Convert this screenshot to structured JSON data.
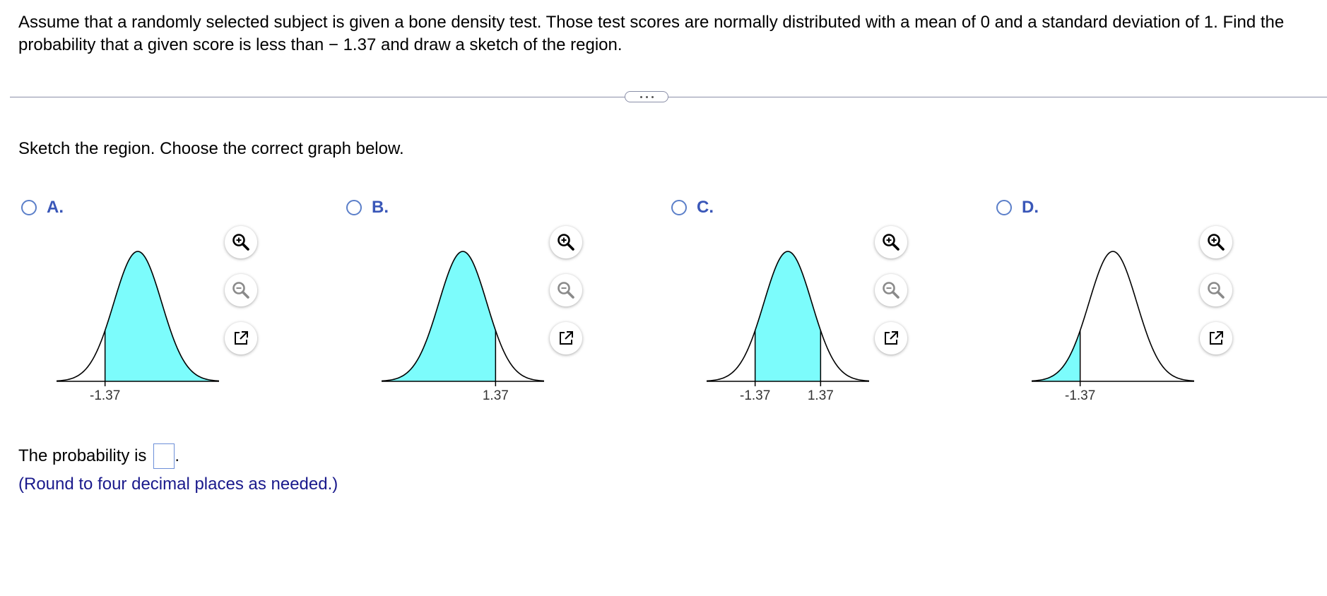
{
  "question": {
    "text": "Assume that a randomly selected subject is given a bone density test. Those test scores are normally distributed with a mean of 0 and a standard deviation of 1. Find the probability that a given score is less than − 1.37 and draw a sketch of the region."
  },
  "prompt": "Sketch the region. Choose the correct graph below.",
  "options": [
    {
      "letter": "A.",
      "label": "-1.37",
      "shade": "right",
      "labels": [
        "-1.37"
      ]
    },
    {
      "letter": "B.",
      "label": "1.37",
      "shade": "left",
      "labels": [
        "1.37"
      ]
    },
    {
      "letter": "C.",
      "label": "-1.37 1.37",
      "shade": "between",
      "labels": [
        "-1.37",
        "1.37"
      ]
    },
    {
      "letter": "D.",
      "label": "-1.37",
      "shade": "left-tail",
      "labels": [
        "-1.37"
      ]
    }
  ],
  "tools": {
    "zoom_in": "zoom-in-icon",
    "zoom_out": "zoom-out-icon",
    "popout": "popout-icon"
  },
  "answer": {
    "prefix": "The probability is",
    "suffix": "."
  },
  "hint": "(Round to four decimal places as needed.)",
  "colors": {
    "shade": "#7cfcfc",
    "accent": "#3a57b8"
  }
}
